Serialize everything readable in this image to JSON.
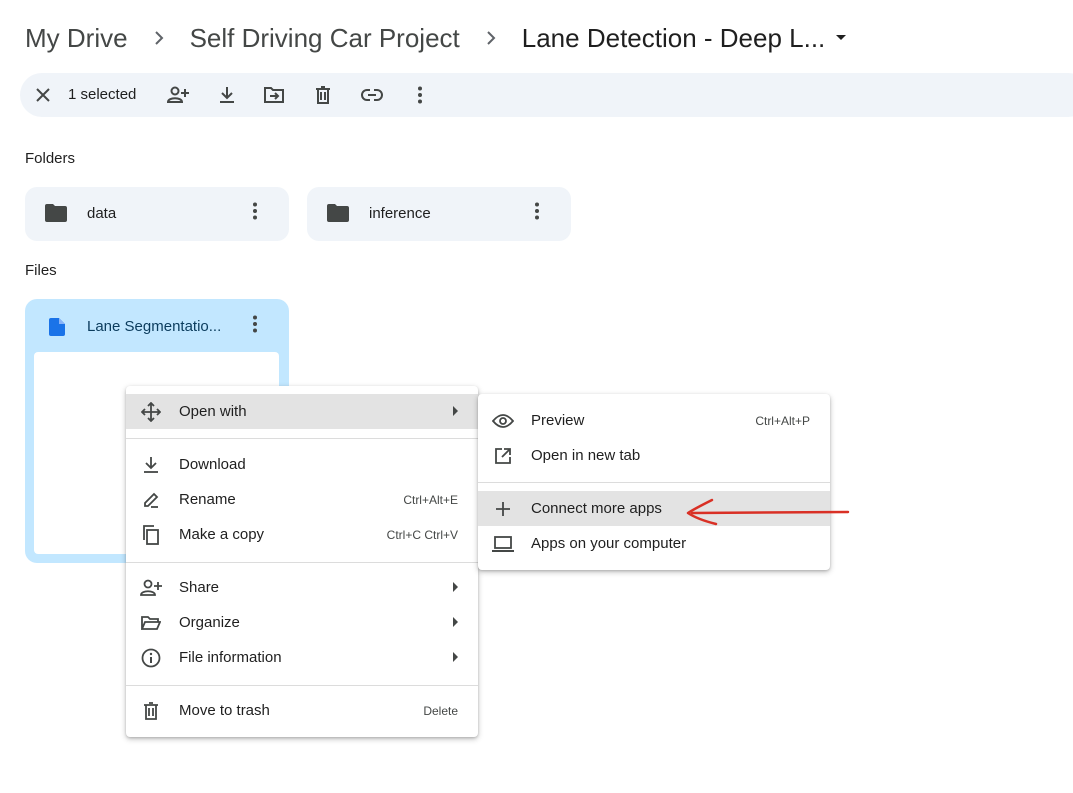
{
  "breadcrumb": {
    "items": [
      "My Drive",
      "Self Driving Car Project",
      "Lane Detection - Deep L..."
    ]
  },
  "action_bar": {
    "selected_label": "1 selected",
    "icons": [
      "close-icon",
      "share-icon",
      "download-icon",
      "move-icon",
      "trash-icon",
      "link-icon",
      "more-vert-icon"
    ]
  },
  "sections": {
    "folders": "Folders",
    "files": "Files"
  },
  "folders": [
    {
      "name": "data"
    },
    {
      "name": "inference"
    }
  ],
  "files": [
    {
      "name": "Lane Segmentatio..."
    }
  ],
  "context_menu": {
    "open_with": {
      "label": "Open with"
    },
    "download": {
      "label": "Download"
    },
    "rename": {
      "label": "Rename",
      "shortcut": "Ctrl+Alt+E"
    },
    "make_copy": {
      "label": "Make a copy",
      "shortcut": "Ctrl+C Ctrl+V"
    },
    "share": {
      "label": "Share"
    },
    "organize": {
      "label": "Organize"
    },
    "file_info": {
      "label": "File information"
    },
    "trash": {
      "label": "Move to trash",
      "shortcut": "Delete"
    }
  },
  "submenu": {
    "preview": {
      "label": "Preview",
      "shortcut": "Ctrl+Alt+P"
    },
    "new_tab": {
      "label": "Open in new tab"
    },
    "connect": {
      "label": "Connect more apps"
    },
    "apps_computer": {
      "label": "Apps on your computer"
    }
  },
  "colors": {
    "selected_card": "#c2e7ff",
    "card_bg": "#f0f4f9",
    "doc_icon": "#1a73e8",
    "highlight": "#e3e3e3",
    "annotation_arrow": "#d93025"
  }
}
